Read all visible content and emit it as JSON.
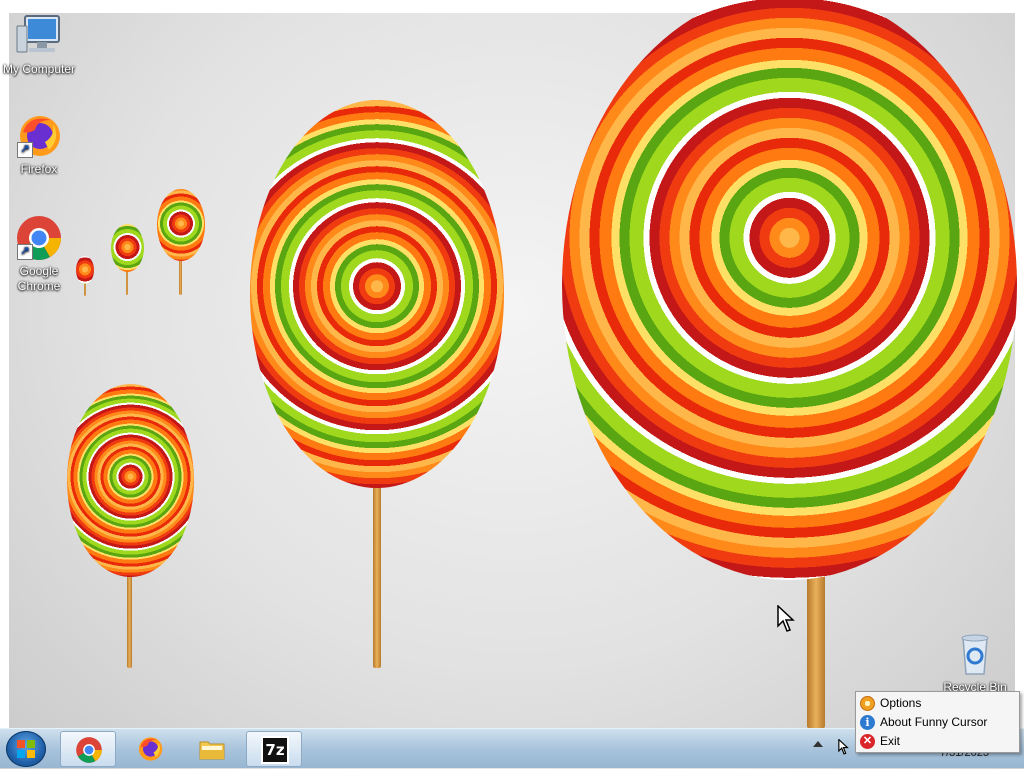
{
  "desktop": {
    "icons": [
      {
        "label": "My Computer"
      },
      {
        "label": "Firefox"
      },
      {
        "label": "Google Chrome"
      },
      {
        "label": "Recycle Bin"
      }
    ]
  },
  "taskbar": {
    "apps": [
      {
        "icon": "chrome-icon"
      },
      {
        "icon": "firefox-icon"
      },
      {
        "icon": "file-explorer-icon"
      },
      {
        "icon": "7zip-icon",
        "label": "7z"
      }
    ],
    "clock": {
      "time": "",
      "date": "7/31/2023"
    }
  },
  "context_menu": {
    "items": [
      {
        "label": "Options",
        "icon": "gear-icon"
      },
      {
        "label": "About Funny Cursor",
        "icon": "info-icon"
      },
      {
        "label": "Exit",
        "icon": "close-icon"
      }
    ]
  },
  "colors": {
    "taskbar": "#a9c4dc",
    "menu_bg": "#f5f5f5",
    "accent": "#1f5fa8"
  }
}
